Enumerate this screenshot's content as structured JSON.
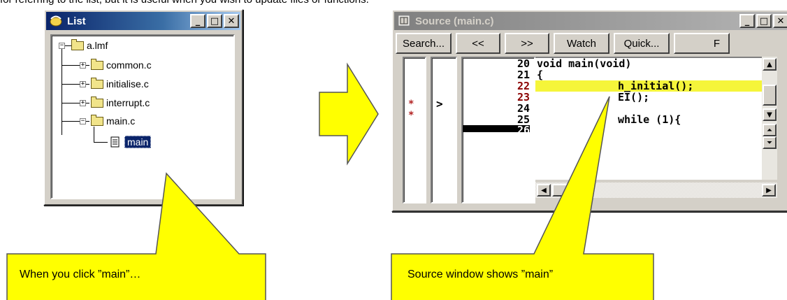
{
  "top_note": "for referring to the list, but it is useful when you wish to update files or functions.",
  "list_window": {
    "title": "List",
    "tree": {
      "root": "a.lmf",
      "items": [
        "common.c",
        "initialise.c",
        "interrupt.c",
        "main.c"
      ],
      "selected_child": "main"
    }
  },
  "source_window": {
    "title": "Source (main.c)",
    "toolbar": [
      "Search...",
      "<<",
      ">>",
      "Watch",
      "Quick...",
      "F"
    ],
    "markers": [
      "*",
      "*"
    ],
    "current_arrow": ">",
    "line_numbers": [
      "20",
      "21",
      "22",
      "23",
      "24",
      "25",
      "26"
    ],
    "code": [
      "void main(void)",
      "{",
      "h_initial();",
      "EI();",
      "",
      "while (1){",
      ""
    ]
  },
  "callouts": {
    "left": "When you click ”main”…",
    "right": "Source window shows ”main”"
  },
  "colors": {
    "callout_fill": "#ffff00",
    "highlight": "#f5f53a",
    "breakpoint_line": "#8b0000",
    "selection": "#0a246a"
  }
}
